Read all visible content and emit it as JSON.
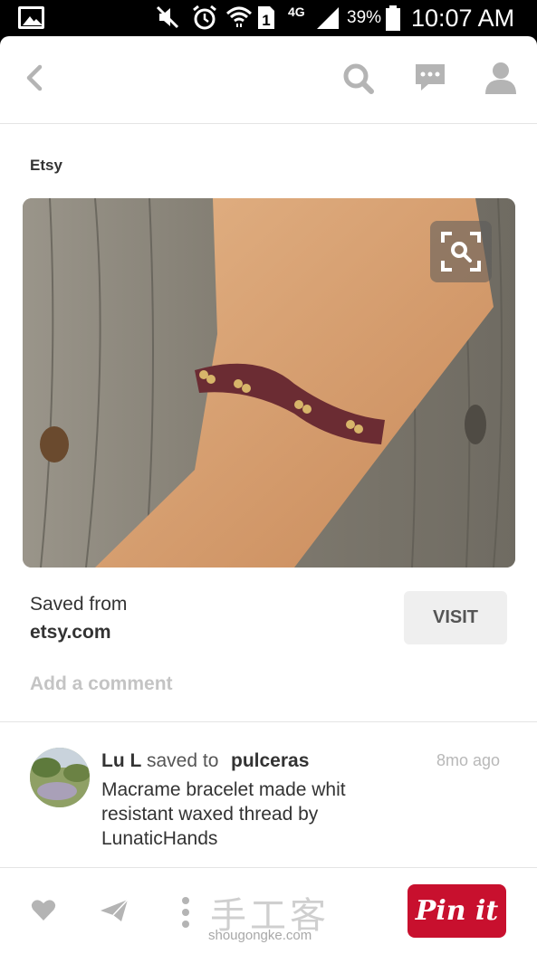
{
  "status_bar": {
    "network": "4G",
    "battery_percent": "39%",
    "time": "10:07 AM",
    "icons": [
      "gallery-icon",
      "mute-icon",
      "alarm-icon",
      "wifi-icon",
      "sim-1-icon",
      "signal-icon",
      "battery-icon"
    ]
  },
  "top_bar": {
    "icons": [
      "back-icon",
      "search-icon",
      "chat-icon",
      "profile-icon"
    ]
  },
  "pin": {
    "source_name": "Etsy",
    "image_icon": "visual-search-icon",
    "saved_from_label": "Saved from",
    "saved_from_domain": "etsy.com",
    "visit_label": "VISIT",
    "add_comment": "Add a comment"
  },
  "activity": {
    "user": "Lu L",
    "verb": "saved to",
    "board": "pulceras",
    "time": "8mo ago",
    "description": "Macrame bracelet made whit resistant waxed thread by LunaticHands"
  },
  "bottom_bar": {
    "icons": [
      "heart-icon",
      "send-icon",
      "more-icon"
    ],
    "watermark_logo": "手工客",
    "watermark_url": "shougongke.com",
    "pinit_label": "Pin it"
  },
  "colors": {
    "pinit_red": "#c8102e",
    "icon_gray": "#b4b4b4",
    "text_dark": "#333333",
    "muted_text": "#c4c4c4"
  }
}
